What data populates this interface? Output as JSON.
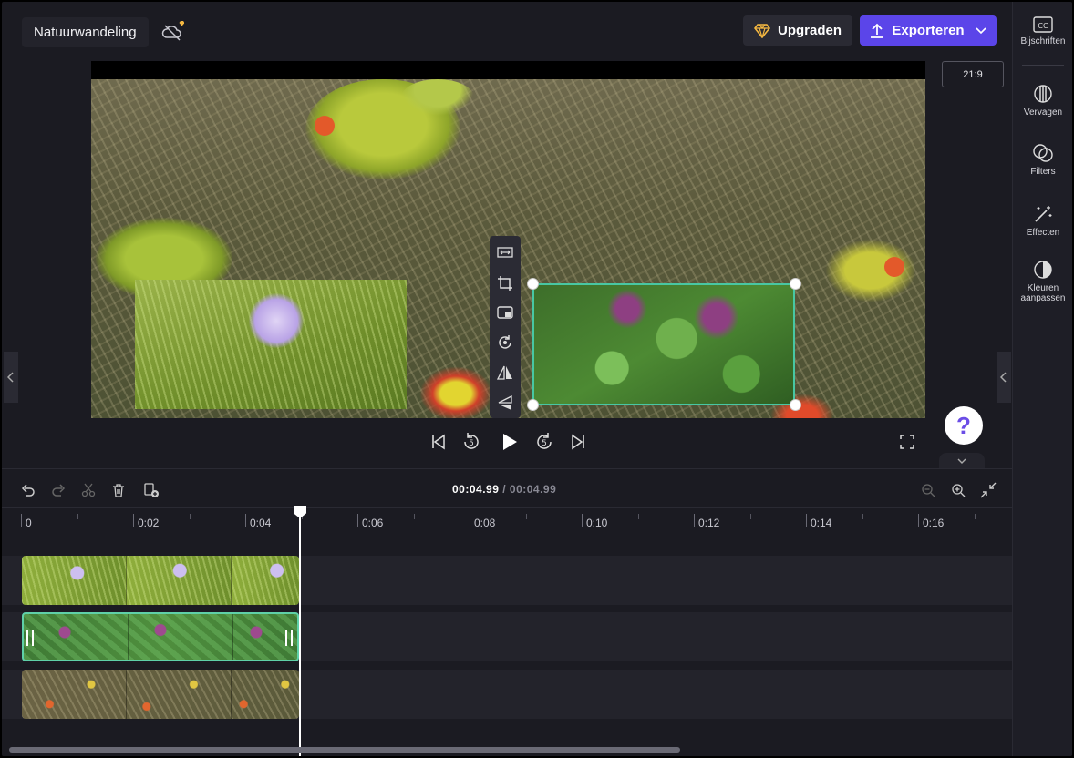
{
  "header": {
    "project_title": "Natuurwandeling",
    "upgrade_label": "Upgraden",
    "export_label": "Exporteren"
  },
  "sidebar": {
    "items": [
      {
        "label": "Bijschriften",
        "icon": "captions-icon"
      },
      {
        "label": "Vervagen",
        "icon": "fade-icon"
      },
      {
        "label": "Filters",
        "icon": "filters-icon"
      },
      {
        "label": "Effecten",
        "icon": "effects-icon"
      },
      {
        "label": "Kleuren aanpassen",
        "icon": "adjust-colors-icon"
      }
    ]
  },
  "preview": {
    "aspect_ratio": "21:9"
  },
  "floating_toolbar": {
    "tools": [
      "fit-icon",
      "crop-icon",
      "picture-in-picture-icon",
      "rotate-icon",
      "flip-horizontal-icon",
      "flip-vertical-icon"
    ]
  },
  "help": {
    "label": "?"
  },
  "timeline": {
    "current_time": "00:04.99",
    "separator": " / ",
    "total_time": "00:04.99",
    "ruler_labels": [
      "0",
      "0:02",
      "0:04",
      "0:06",
      "0:08",
      "0:10",
      "0:12",
      "0:14",
      "0:16"
    ],
    "tracks": [
      {
        "clip": "grass-flower-clip",
        "selected": false
      },
      {
        "clip": "plant-clip",
        "selected": true
      },
      {
        "clip": "meadow-flowers-clip",
        "selected": false
      }
    ]
  },
  "colors": {
    "accent": "#5b45e9",
    "selection": "#48c7a3",
    "background": "#1b1b22"
  }
}
